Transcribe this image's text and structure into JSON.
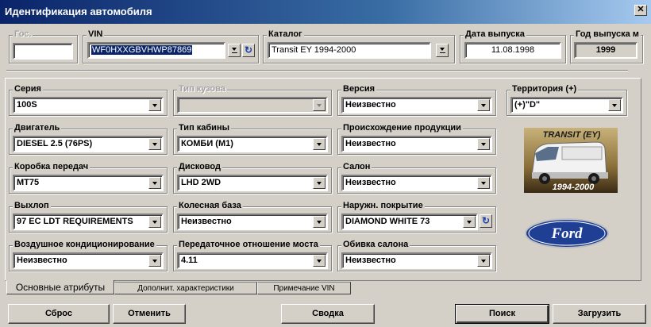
{
  "window": {
    "title": "Идентификация автомобиля",
    "close_label": "✕"
  },
  "top": {
    "gos": {
      "label": "Гос.",
      "value": ""
    },
    "vin": {
      "label": "VIN",
      "value": "WF0HXXGBVHWP87869"
    },
    "catalog": {
      "label": "Каталог",
      "value": "Transit EY 1994-2000"
    },
    "release_date": {
      "label": "Дата выпуска",
      "value": "11.08.1998"
    },
    "model_year": {
      "label": "Год выпуска м",
      "value": "1999"
    }
  },
  "attributes": [
    {
      "key": "series",
      "label": "Серия",
      "value": "100S"
    },
    {
      "key": "body_type",
      "label": "Тип кузова",
      "value": "",
      "disabled": true
    },
    {
      "key": "version",
      "label": "Версия",
      "value": "Неизвестно"
    },
    {
      "key": "territory",
      "label": "Территория (+)",
      "value": "(+)\"D\""
    },
    {
      "key": "engine",
      "label": "Двигатель",
      "value": "DIESEL 2.5 (76PS)"
    },
    {
      "key": "cab_type",
      "label": "Тип кабины",
      "value": "КОМБИ (M1)"
    },
    {
      "key": "origin",
      "label": "Происхождение продукции",
      "value": "Неизвестно"
    },
    {
      "key": "gearbox",
      "label": "Коробка передач",
      "value": "MT75"
    },
    {
      "key": "drive",
      "label": "Дисковод",
      "value": "LHD 2WD"
    },
    {
      "key": "interior",
      "label": "Салон",
      "value": "Неизвестно"
    },
    {
      "key": "exhaust",
      "label": "Выхлоп",
      "value": "97 EC LDT REQUIREMENTS"
    },
    {
      "key": "wheelbase",
      "label": "Колесная база",
      "value": "Неизвестно"
    },
    {
      "key": "paint",
      "label": "Наружн. покрытие",
      "value": "DIAMOND WHITE 73"
    },
    {
      "key": "aircon",
      "label": "Воздушное кондиционирование",
      "value": "Неизвестно"
    },
    {
      "key": "axle_ratio",
      "label": "Передаточное отношение моста",
      "value": "4.11"
    },
    {
      "key": "upholstery",
      "label": "Обивка салона",
      "value": "Неизвестно"
    }
  ],
  "images": {
    "van_caption_top": "TRANSIT (EY)",
    "van_caption_bottom": "1994-2000",
    "brand": "Ford"
  },
  "tabs": [
    {
      "label": "Основные атрибуты",
      "active": true
    },
    {
      "label": "Дополнит. характеристики",
      "active": false
    },
    {
      "label": "Примечание VIN",
      "active": false
    }
  ],
  "buttons": {
    "reset": "Сброс",
    "cancel": "Отменить",
    "summary": "Сводка",
    "search": "Поиск",
    "load": "Загрузить"
  },
  "colors": {
    "titlebar_start": "#0a246a",
    "titlebar_end": "#a6caf0",
    "selection": "#0a246a",
    "ford_blue": "#1f3f95",
    "face": "#d4d0c8"
  }
}
